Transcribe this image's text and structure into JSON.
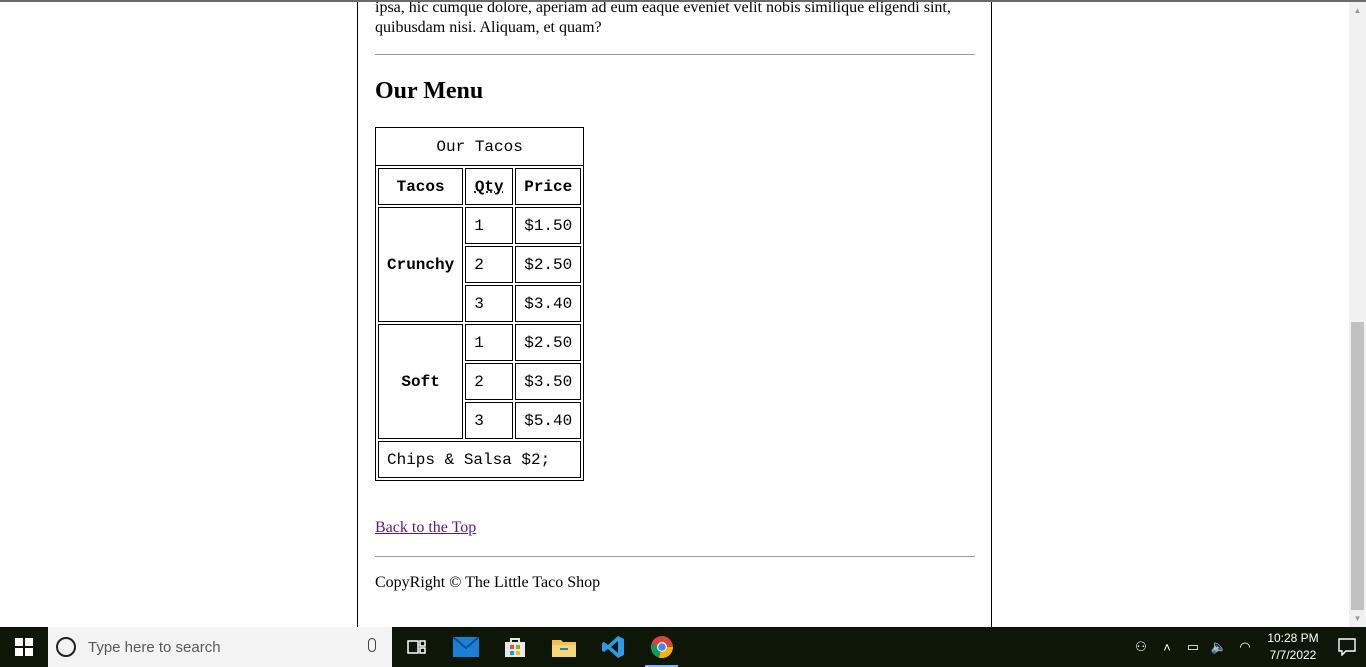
{
  "page": {
    "intro_text": "ipsa, hic cumque dolore, aperiam ad eum eaque eveniet velit nobis similique eligendi sint, quibusdam nisi. Aliquam, et quam?",
    "menu_heading": "Our Menu",
    "table": {
      "caption": "Our Tacos",
      "headers": {
        "tacos": "Tacos",
        "qty": "Qty",
        "price": "Price"
      },
      "groups": [
        {
          "name": "Crunchy",
          "rows": [
            {
              "qty": "1",
              "price": "$1.50"
            },
            {
              "qty": "2",
              "price": "$2.50"
            },
            {
              "qty": "3",
              "price": "$3.40"
            }
          ]
        },
        {
          "name": "Soft",
          "rows": [
            {
              "qty": "1",
              "price": "$2.50"
            },
            {
              "qty": "2",
              "price": "$3.50"
            },
            {
              "qty": "3",
              "price": "$5.40"
            }
          ]
        }
      ],
      "footer": "Chips & Salsa $2;"
    },
    "back_to_top": "Back to the Top",
    "copyright": "CopyRight © The Little Taco Shop"
  },
  "taskbar": {
    "search_placeholder": "Type here to search",
    "time": "10:28 PM",
    "date": "7/7/2022",
    "apps": [
      "task-view",
      "mail",
      "store",
      "file-explorer",
      "vscode",
      "chrome"
    ]
  },
  "colors": {
    "link_visited": "#551a8b",
    "taskbar_bg": "#0e1608",
    "active_indicator": "#8ab4f8"
  }
}
